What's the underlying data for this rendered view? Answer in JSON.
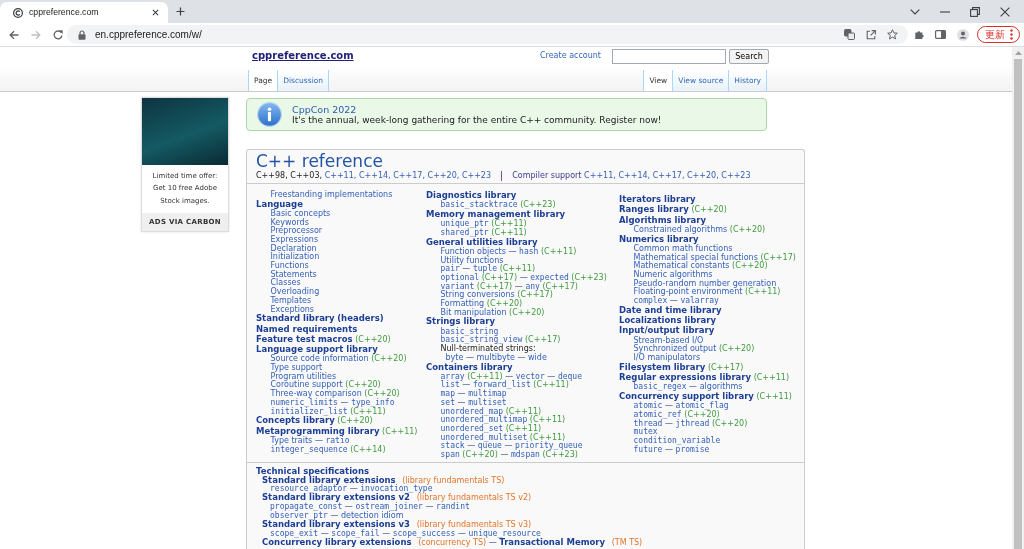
{
  "browser": {
    "tab_title": "cppreference.com",
    "url": "en.cppreference.com/w/",
    "forward_disabled": true,
    "update_label": "更新"
  },
  "header": {
    "site_title": "cppreference.com",
    "create_account": "Create account",
    "search_button": "Search"
  },
  "page_tabs": [
    {
      "label": "Page",
      "selected": true
    },
    {
      "label": "Discussion",
      "selected": false
    }
  ],
  "view_tabs": [
    {
      "label": "View",
      "selected": true
    },
    {
      "label": "View source",
      "selected": false
    },
    {
      "label": "History",
      "selected": false
    }
  ],
  "ad": {
    "text": "Limited time offer: Get 10 free Adobe Stock images.",
    "footer": "ADS VIA CARBON"
  },
  "notice": {
    "title": "CppCon 2022",
    "text": "It's the annual, week-long gathering for the entire C++ community.",
    "link": "Register now!"
  },
  "reference": {
    "title": "C++ reference",
    "standards": [
      {
        "kind": "text",
        "text": "C++98,"
      },
      {
        "kind": "text",
        "text": "C++03,"
      },
      {
        "kind": "link",
        "text": "C++11,"
      },
      {
        "kind": "link",
        "text": "C++14,"
      },
      {
        "kind": "link",
        "text": "C++17,"
      },
      {
        "kind": "link",
        "text": "C++20,"
      },
      {
        "kind": "link",
        "text": "C++23"
      }
    ],
    "compiler_support": [
      {
        "kind": "visited",
        "text": "Compiler support"
      },
      {
        "kind": "link",
        "text": "C++11,"
      },
      {
        "kind": "link",
        "text": "C++14,"
      },
      {
        "kind": "link",
        "text": "C++17,"
      },
      {
        "kind": "link",
        "text": "C++20,"
      },
      {
        "kind": "link",
        "text": "C++23"
      }
    ],
    "columns": [
      [
        {
          "children": [
            {
              "parts": [
                {
                  "kind": "link",
                  "text": "Freestanding implementations"
                }
              ]
            }
          ]
        },
        {
          "parts": [
            {
              "kind": "heading",
              "text": "Language"
            }
          ],
          "children": [
            {
              "parts": [
                {
                  "kind": "link",
                  "text": "Basic concepts"
                }
              ]
            },
            {
              "parts": [
                {
                  "kind": "link",
                  "text": "Keywords"
                }
              ]
            },
            {
              "parts": [
                {
                  "kind": "link",
                  "text": "Preprocessor"
                }
              ]
            },
            {
              "parts": [
                {
                  "kind": "link",
                  "text": "Expressions"
                }
              ]
            },
            {
              "parts": [
                {
                  "kind": "link",
                  "text": "Declaration"
                }
              ]
            },
            {
              "parts": [
                {
                  "kind": "link",
                  "text": "Initialization"
                }
              ]
            },
            {
              "parts": [
                {
                  "kind": "link",
                  "text": "Functions"
                }
              ]
            },
            {
              "parts": [
                {
                  "kind": "link",
                  "text": "Statements"
                }
              ]
            },
            {
              "parts": [
                {
                  "kind": "link",
                  "text": "Classes"
                }
              ]
            },
            {
              "parts": [
                {
                  "kind": "link",
                  "text": "Overloading"
                }
              ]
            },
            {
              "parts": [
                {
                  "kind": "link",
                  "text": "Templates"
                }
              ]
            },
            {
              "parts": [
                {
                  "kind": "link",
                  "text": "Exceptions"
                }
              ]
            }
          ]
        },
        {
          "parts": [
            {
              "kind": "heading",
              "text": "Standard library"
            },
            {
              "kind": "heading",
              "text": "(headers)"
            }
          ]
        },
        {
          "parts": [
            {
              "kind": "heading",
              "text": "Named requirements"
            }
          ]
        },
        {
          "parts": [
            {
              "kind": "heading",
              "text": "Feature test macros"
            },
            {
              "kind": "version",
              "text": "(C++20)"
            }
          ]
        },
        {
          "parts": [
            {
              "kind": "heading",
              "text": "Language support library"
            }
          ],
          "children": [
            {
              "parts": [
                {
                  "kind": "link",
                  "text": "Source code information"
                },
                {
                  "kind": "version",
                  "text": "(C++20)"
                }
              ]
            },
            {
              "parts": [
                {
                  "kind": "link",
                  "text": "Type support"
                }
              ]
            },
            {
              "parts": [
                {
                  "kind": "link",
                  "text": "Program utilities"
                }
              ]
            },
            {
              "parts": [
                {
                  "kind": "link",
                  "text": "Coroutine support"
                },
                {
                  "kind": "version",
                  "text": "(C++20)"
                }
              ]
            },
            {
              "parts": [
                {
                  "kind": "link",
                  "text": "Three-way comparison"
                },
                {
                  "kind": "version",
                  "text": "(C++20)"
                }
              ]
            },
            {
              "parts": [
                {
                  "kind": "code",
                  "text": "numeric_limits"
                },
                {
                  "kind": "dash",
                  "text": "—"
                },
                {
                  "kind": "code",
                  "text": "type_info"
                }
              ]
            },
            {
              "parts": [
                {
                  "kind": "code",
                  "text": "initializer_list"
                },
                {
                  "kind": "version",
                  "text": "(C++11)"
                }
              ]
            }
          ]
        },
        {
          "parts": [
            {
              "kind": "heading",
              "text": "Concepts library"
            },
            {
              "kind": "version",
              "text": "(C++20)"
            }
          ]
        },
        {
          "parts": [
            {
              "kind": "heading",
              "text": "Metaprogramming library"
            },
            {
              "kind": "version",
              "text": "(C++11)"
            }
          ],
          "children": [
            {
              "parts": [
                {
                  "kind": "link",
                  "text": "Type traits"
                },
                {
                  "kind": "dash",
                  "text": "—"
                },
                {
                  "kind": "code",
                  "text": "ratio"
                }
              ]
            },
            {
              "parts": [
                {
                  "kind": "code",
                  "text": "integer_sequence"
                },
                {
                  "kind": "version",
                  "text": "(C++14)"
                }
              ]
            }
          ]
        }
      ],
      [
        {
          "parts": [
            {
              "kind": "heading",
              "text": "Diagnostics library"
            }
          ],
          "children": [
            {
              "parts": [
                {
                  "kind": "code",
                  "text": "basic_stacktrace"
                },
                {
                  "kind": "version",
                  "text": "(C++23)"
                }
              ]
            }
          ]
        },
        {
          "parts": [
            {
              "kind": "heading",
              "text": "Memory management library"
            }
          ],
          "children": [
            {
              "parts": [
                {
                  "kind": "code",
                  "text": "unique_ptr"
                },
                {
                  "kind": "version",
                  "text": "(C++11)"
                }
              ]
            },
            {
              "parts": [
                {
                  "kind": "code",
                  "text": "shared_ptr"
                },
                {
                  "kind": "version",
                  "text": "(C++11)"
                }
              ]
            }
          ]
        },
        {
          "parts": [
            {
              "kind": "heading",
              "text": "General utilities library"
            }
          ],
          "children": [
            {
              "parts": [
                {
                  "kind": "link",
                  "text": "Function objects"
                },
                {
                  "kind": "dash",
                  "text": "—"
                },
                {
                  "kind": "code",
                  "text": "hash"
                },
                {
                  "kind": "version",
                  "text": "(C++11)"
                }
              ]
            },
            {
              "parts": [
                {
                  "kind": "link",
                  "text": "Utility functions"
                }
              ]
            },
            {
              "parts": [
                {
                  "kind": "code",
                  "text": "pair"
                },
                {
                  "kind": "dash",
                  "text": "—"
                },
                {
                  "kind": "code",
                  "text": "tuple"
                },
                {
                  "kind": "version",
                  "text": "(C++11)"
                }
              ]
            },
            {
              "parts": [
                {
                  "kind": "code",
                  "text": "optional"
                },
                {
                  "kind": "version",
                  "text": "(C++17)"
                },
                {
                  "kind": "dash",
                  "text": "—"
                },
                {
                  "kind": "code",
                  "text": "expected"
                },
                {
                  "kind": "version",
                  "text": "(C++23)"
                }
              ]
            },
            {
              "parts": [
                {
                  "kind": "code",
                  "text": "variant"
                },
                {
                  "kind": "version",
                  "text": "(C++17)"
                },
                {
                  "kind": "dash",
                  "text": "—"
                },
                {
                  "kind": "code",
                  "text": "any"
                },
                {
                  "kind": "version",
                  "text": "(C++17)"
                }
              ]
            },
            {
              "parts": [
                {
                  "kind": "link",
                  "text": "String conversions"
                },
                {
                  "kind": "version",
                  "text": "(C++17)"
                }
              ]
            },
            {
              "parts": [
                {
                  "kind": "link",
                  "text": "Formatting"
                },
                {
                  "kind": "version",
                  "text": "(C++20)"
                }
              ]
            },
            {
              "parts": [
                {
                  "kind": "link",
                  "text": "Bit manipulation"
                },
                {
                  "kind": "version",
                  "text": "(C++20)"
                }
              ]
            }
          ]
        },
        {
          "parts": [
            {
              "kind": "heading",
              "text": "Strings library"
            }
          ],
          "children": [
            {
              "parts": [
                {
                  "kind": "code",
                  "text": "basic_string"
                }
              ]
            },
            {
              "parts": [
                {
                  "kind": "code",
                  "text": "basic_string_view"
                },
                {
                  "kind": "version",
                  "text": "(C++17)"
                }
              ]
            },
            {
              "parts": [
                {
                  "kind": "text",
                  "text": "Null-terminated strings:"
                }
              ],
              "children": [
                {
                  "parts": [
                    {
                      "kind": "link",
                      "text": "byte"
                    },
                    {
                      "kind": "dash",
                      "text": "—"
                    },
                    {
                      "kind": "link",
                      "text": "multibyte"
                    },
                    {
                      "kind": "dash",
                      "text": "—"
                    },
                    {
                      "kind": "link",
                      "text": "wide"
                    }
                  ]
                }
              ]
            }
          ]
        },
        {
          "parts": [
            {
              "kind": "heading",
              "text": "Containers library"
            }
          ],
          "children": [
            {
              "parts": [
                {
                  "kind": "code",
                  "text": "array"
                },
                {
                  "kind": "version",
                  "text": "(C++11)"
                },
                {
                  "kind": "dash",
                  "text": "—"
                },
                {
                  "kind": "code",
                  "text": "vector"
                },
                {
                  "kind": "dash",
                  "text": "—"
                },
                {
                  "kind": "code",
                  "text": "deque"
                }
              ]
            },
            {
              "parts": [
                {
                  "kind": "code",
                  "text": "list"
                },
                {
                  "kind": "dash",
                  "text": "—"
                },
                {
                  "kind": "code",
                  "text": "forward_list"
                },
                {
                  "kind": "version",
                  "text": "(C++11)"
                }
              ]
            },
            {
              "parts": [
                {
                  "kind": "code",
                  "text": "map"
                },
                {
                  "kind": "dash",
                  "text": "—"
                },
                {
                  "kind": "code",
                  "text": "multimap"
                }
              ]
            },
            {
              "parts": [
                {
                  "kind": "code",
                  "text": "set"
                },
                {
                  "kind": "dash",
                  "text": "—"
                },
                {
                  "kind": "code",
                  "text": "multiset"
                }
              ]
            },
            {
              "parts": [
                {
                  "kind": "code",
                  "text": "unordered_map"
                },
                {
                  "kind": "version",
                  "text": "(C++11)"
                }
              ]
            },
            {
              "parts": [
                {
                  "kind": "code",
                  "text": "unordered_multimap"
                },
                {
                  "kind": "version",
                  "text": "(C++11)"
                }
              ]
            },
            {
              "parts": [
                {
                  "kind": "code",
                  "text": "unordered_set"
                },
                {
                  "kind": "version",
                  "text": "(C++11)"
                }
              ]
            },
            {
              "parts": [
                {
                  "kind": "code",
                  "text": "unordered_multiset"
                },
                {
                  "kind": "version",
                  "text": "(C++11)"
                }
              ]
            },
            {
              "parts": [
                {
                  "kind": "code",
                  "text": "stack"
                },
                {
                  "kind": "dash",
                  "text": "—"
                },
                {
                  "kind": "code",
                  "text": "queue"
                },
                {
                  "kind": "dash",
                  "text": "—"
                },
                {
                  "kind": "code",
                  "text": "priority_queue"
                }
              ]
            },
            {
              "parts": [
                {
                  "kind": "code",
                  "text": "span"
                },
                {
                  "kind": "version",
                  "text": "(C++20)"
                },
                {
                  "kind": "dash",
                  "text": "—"
                },
                {
                  "kind": "code",
                  "text": "mdspan"
                },
                {
                  "kind": "version",
                  "text": "(C++23)"
                }
              ]
            }
          ]
        }
      ],
      [
        {
          "parts": [
            {
              "kind": "heading",
              "text": "Iterators library"
            }
          ]
        },
        {
          "parts": [
            {
              "kind": "heading",
              "text": "Ranges library"
            },
            {
              "kind": "version",
              "text": "(C++20)"
            }
          ]
        },
        {
          "parts": [
            {
              "kind": "heading",
              "text": "Algorithms library"
            }
          ],
          "children": [
            {
              "parts": [
                {
                  "kind": "link",
                  "text": "Constrained algorithms"
                },
                {
                  "kind": "version",
                  "text": "(C++20)"
                }
              ]
            }
          ]
        },
        {
          "parts": [
            {
              "kind": "heading",
              "text": "Numerics library"
            }
          ],
          "children": [
            {
              "parts": [
                {
                  "kind": "link",
                  "text": "Common math functions"
                }
              ]
            },
            {
              "parts": [
                {
                  "kind": "link",
                  "text": "Mathematical special functions"
                },
                {
                  "kind": "version",
                  "text": "(C++17)"
                }
              ]
            },
            {
              "parts": [
                {
                  "kind": "link",
                  "text": "Mathematical constants"
                },
                {
                  "kind": "version",
                  "text": "(C++20)"
                }
              ]
            },
            {
              "parts": [
                {
                  "kind": "link",
                  "text": "Numeric algorithms"
                }
              ]
            },
            {
              "parts": [
                {
                  "kind": "link",
                  "text": "Pseudo-random number generation"
                }
              ]
            },
            {
              "parts": [
                {
                  "kind": "link",
                  "text": "Floating-point environment"
                },
                {
                  "kind": "version",
                  "text": "(C++11)"
                }
              ]
            },
            {
              "parts": [
                {
                  "kind": "code",
                  "text": "complex"
                },
                {
                  "kind": "dash",
                  "text": "—"
                },
                {
                  "kind": "code",
                  "text": "valarray"
                }
              ]
            }
          ]
        },
        {
          "parts": [
            {
              "kind": "heading",
              "text": "Date and time library"
            }
          ]
        },
        {
          "parts": [
            {
              "kind": "heading",
              "text": "Localizations library"
            }
          ]
        },
        {
          "parts": [
            {
              "kind": "heading",
              "text": "Input/output library"
            }
          ],
          "children": [
            {
              "parts": [
                {
                  "kind": "link",
                  "text": "Stream-based I/O"
                }
              ]
            },
            {
              "parts": [
                {
                  "kind": "link",
                  "text": "Synchronized output"
                },
                {
                  "kind": "version",
                  "text": "(C++20)"
                }
              ]
            },
            {
              "parts": [
                {
                  "kind": "link",
                  "text": "I/O manipulators"
                }
              ]
            }
          ]
        },
        {
          "parts": [
            {
              "kind": "heading",
              "text": "Filesystem library"
            },
            {
              "kind": "version",
              "text": "(C++17)"
            }
          ]
        },
        {
          "parts": [
            {
              "kind": "heading",
              "text": "Regular expressions library"
            },
            {
              "kind": "version",
              "text": "(C++11)"
            }
          ],
          "children": [
            {
              "parts": [
                {
                  "kind": "code",
                  "text": "basic_regex"
                },
                {
                  "kind": "dash",
                  "text": "—"
                },
                {
                  "kind": "link",
                  "text": "algorithms"
                }
              ]
            }
          ]
        },
        {
          "parts": [
            {
              "kind": "heading",
              "text": "Concurrency support library"
            },
            {
              "kind": "version",
              "text": "(C++11)"
            }
          ],
          "children": [
            {
              "parts": [
                {
                  "kind": "code",
                  "text": "atomic"
                },
                {
                  "kind": "dash",
                  "text": "—"
                },
                {
                  "kind": "code",
                  "text": "atomic_flag"
                }
              ]
            },
            {
              "parts": [
                {
                  "kind": "code",
                  "text": "atomic_ref"
                },
                {
                  "kind": "version",
                  "text": "(C++20)"
                }
              ]
            },
            {
              "parts": [
                {
                  "kind": "code",
                  "text": "thread"
                },
                {
                  "kind": "dash",
                  "text": "—"
                },
                {
                  "kind": "code",
                  "text": "jthread"
                },
                {
                  "kind": "version",
                  "text": "(C++20)"
                }
              ]
            },
            {
              "parts": [
                {
                  "kind": "code",
                  "text": "mutex"
                }
              ]
            },
            {
              "parts": [
                {
                  "kind": "code",
                  "text": "condition_variable"
                }
              ]
            },
            {
              "parts": [
                {
                  "kind": "code",
                  "text": "future"
                },
                {
                  "kind": "dash",
                  "text": "—"
                },
                {
                  "kind": "code",
                  "text": "promise"
                }
              ]
            }
          ]
        }
      ]
    ],
    "technical_specifications": [
      {
        "parts": [
          {
            "kind": "heading",
            "text": "Technical specifications"
          }
        ],
        "children": [
          {
            "parts": [
              {
                "kind": "heading",
                "text": "Standard library extensions"
              },
              {
                "kind": "ts",
                "text": "(library fundamentals TS)"
              }
            ],
            "children": [
              {
                "parts": [
                  {
                    "kind": "code",
                    "text": "resource_adaptor"
                  },
                  {
                    "kind": "dash",
                    "text": "—"
                  },
                  {
                    "kind": "code",
                    "text": "invocation_type"
                  }
                ]
              }
            ]
          },
          {
            "parts": [
              {
                "kind": "heading",
                "text": "Standard library extensions v2"
              },
              {
                "kind": "ts",
                "text": "(library fundamentals TS v2)"
              }
            ],
            "children": [
              {
                "parts": [
                  {
                    "kind": "code",
                    "text": "propagate_const"
                  },
                  {
                    "kind": "dash",
                    "text": "—"
                  },
                  {
                    "kind": "code",
                    "text": "ostream_joiner"
                  },
                  {
                    "kind": "dash",
                    "text": "—"
                  },
                  {
                    "kind": "code",
                    "text": "randint"
                  }
                ]
              },
              {
                "parts": [
                  {
                    "kind": "code",
                    "text": "observer_ptr"
                  },
                  {
                    "kind": "dash",
                    "text": "—"
                  },
                  {
                    "kind": "link",
                    "text": "detection idiom"
                  }
                ]
              }
            ]
          },
          {
            "parts": [
              {
                "kind": "heading",
                "text": "Standard library extensions v3"
              },
              {
                "kind": "ts",
                "text": "(library fundamentals TS v3)"
              }
            ],
            "children": [
              {
                "parts": [
                  {
                    "kind": "code",
                    "text": "scope_exit"
                  },
                  {
                    "kind": "dash",
                    "text": "—"
                  },
                  {
                    "kind": "code",
                    "text": "scope_fail"
                  },
                  {
                    "kind": "dash",
                    "text": "—"
                  },
                  {
                    "kind": "code",
                    "text": "scope_success"
                  },
                  {
                    "kind": "dash",
                    "text": "—"
                  },
                  {
                    "kind": "code",
                    "text": "unique_resource"
                  }
                ]
              }
            ]
          },
          {
            "parts": [
              {
                "kind": "heading",
                "text": "Concurrency library extensions"
              },
              {
                "kind": "ts",
                "text": "(concurrency TS)"
              },
              {
                "kind": "dash",
                "text": "—"
              },
              {
                "kind": "heading",
                "text": "Transactional Memory"
              },
              {
                "kind": "ts",
                "text": "(TM TS)"
              }
            ]
          }
        ]
      }
    ]
  }
}
